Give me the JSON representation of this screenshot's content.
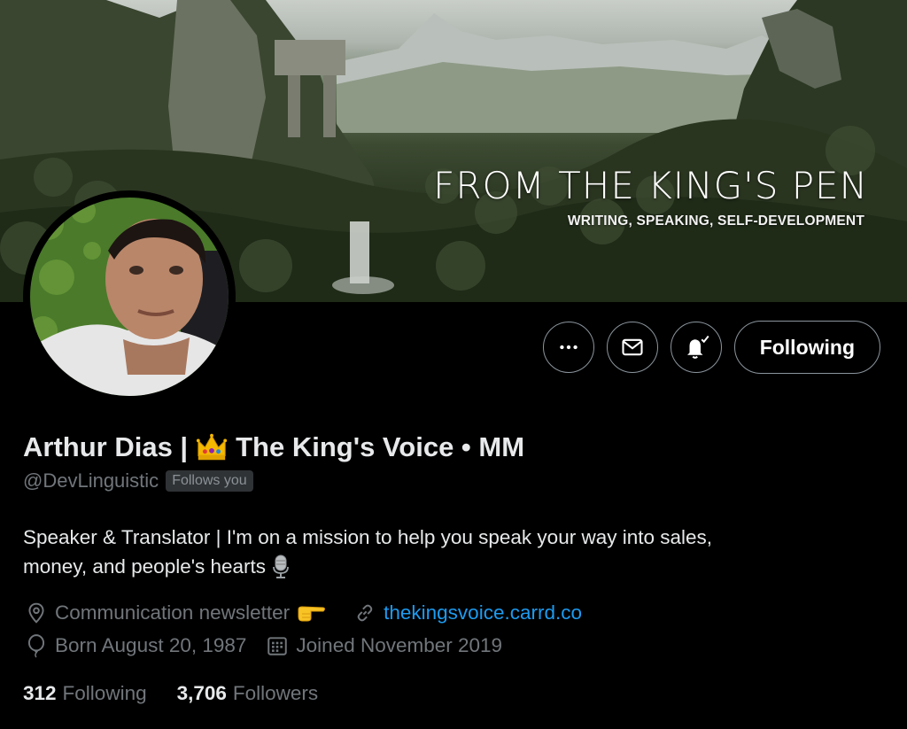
{
  "banner": {
    "title": "FROM THE KING'S PEN",
    "subtitle": "WRITING, SPEAKING, SELF-DEVELOPMENT"
  },
  "actions": {
    "more_icon": "more-horizontal-icon",
    "message_icon": "envelope-icon",
    "notify_icon": "bell-check-icon",
    "following_label": "Following"
  },
  "profile": {
    "name_prefix": "Arthur Dias |",
    "name_emoji": "crown-icon",
    "name_suffix": "The King's Voice • MM",
    "handle": "@DevLinguistic",
    "follows_you": "Follows you",
    "bio_line1": "Speaker & Translator | I'm on a mission to help you speak your way into sales,",
    "bio_line2": "money, and people's hearts",
    "bio_emoji": "microphone-icon",
    "location": "Communication newsletter",
    "location_emoji": "pointing-hand-icon",
    "website": "thekingsvoice.carrd.co",
    "born": "Born August 20, 1987",
    "joined": "Joined November 2019"
  },
  "stats": {
    "following_count": "312",
    "following_label": "Following",
    "followers_count": "3,706",
    "followers_label": "Followers"
  },
  "colors": {
    "background": "#000000",
    "text_primary": "#e7e9ea",
    "text_secondary": "#71767b",
    "link": "#1d9bf0",
    "button_border": "#8b959d"
  }
}
